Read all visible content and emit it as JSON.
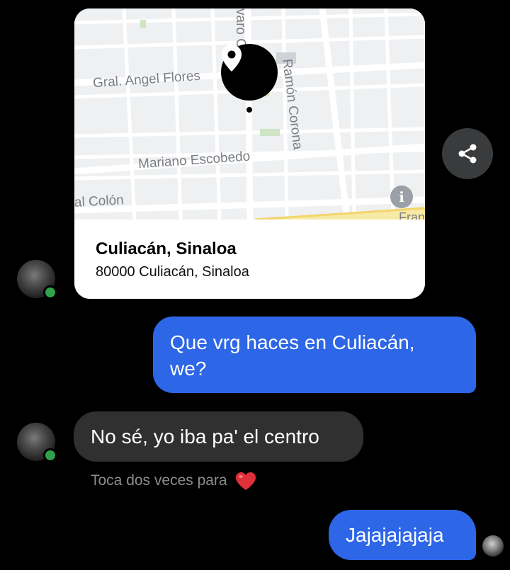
{
  "location_card": {
    "map_labels": {
      "street_1": "Gral. Angel Flores",
      "street_2": "Mariano Escobedo",
      "street_3": "al Colón",
      "street_4": "Ramón Corona",
      "street_5": "varo O",
      "street_6": "Fran"
    },
    "place_name": "Culiacán, Sinaloa",
    "place_address": "80000 Culiacán, Sinaloa",
    "info_symbol": "i",
    "pin_icon": "map-pin-icon"
  },
  "share_icon": "share-icon",
  "messages": [
    {
      "direction": "outgoing",
      "text_line1": "Que vrg haces en Culiacán,",
      "text_line2": "we?"
    },
    {
      "direction": "incoming",
      "text": "No sé, yo iba pa' el centro"
    },
    {
      "direction": "outgoing",
      "text": "Jajajajajaja"
    }
  ],
  "reaction_hint": "Toca dos veces para",
  "reaction_icon": "heart-icon",
  "colors": {
    "outgoing_bubble": "#2d66e6",
    "incoming_bubble": "#303030",
    "online_status": "#31a24c",
    "background": "#000000"
  }
}
